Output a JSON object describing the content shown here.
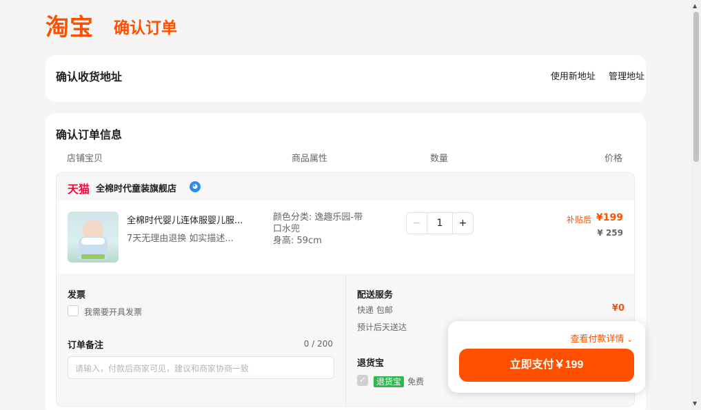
{
  "header": {
    "logo_text": "淘宝",
    "title": "确认订单"
  },
  "address": {
    "title": "确认收货地址",
    "new_address": "使用新地址",
    "manage_address": "管理地址"
  },
  "order": {
    "title": "确认订单信息",
    "columns": [
      "店铺宝贝",
      "商品属性",
      "数量",
      "价格"
    ],
    "shop": {
      "platform": "天猫",
      "name": "全棉时代童装旗舰店",
      "chat_icon": "wangwang-icon"
    },
    "item": {
      "name": "全棉时代婴儿连体服婴儿服...",
      "subtitle": "7天无理由退换  如实描述...",
      "attr_color": "颜色分类: 逸趣乐园-带口水兜",
      "attr_height": "身高: 59cm",
      "quantity": "1",
      "minus": "−",
      "plus": "+",
      "price_label": "补贴后",
      "price_now": "¥199",
      "price_original": "¥ 259"
    },
    "invoice": {
      "title": "发票",
      "checkbox_label": "我需要开具发票"
    },
    "remark": {
      "title": "订单备注",
      "counter": "0 / 200",
      "placeholder": "请输入，付款后商家可见，建议和商家协商一致"
    },
    "delivery": {
      "title": "配送服务",
      "method": "快递 包邮",
      "fee": "¥0",
      "estimate": "预计后天送达"
    },
    "return_insurance": {
      "title": "退货宝",
      "badge": "退货宝",
      "label": "免费"
    }
  },
  "pay": {
    "detail_link": "查看付款详情",
    "button": "立即支付￥199"
  },
  "colors": {
    "brand": "#ff5000",
    "tmall": "#ff0036",
    "green": "#2dba4e"
  }
}
